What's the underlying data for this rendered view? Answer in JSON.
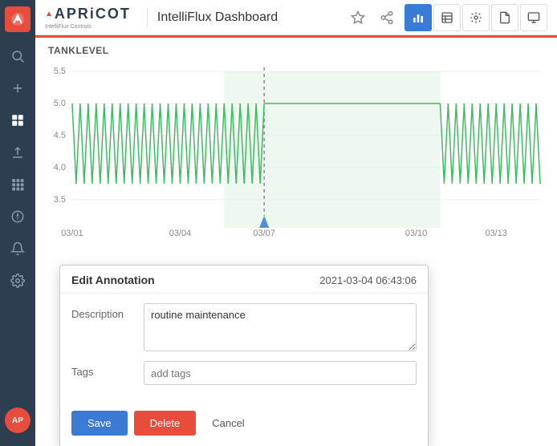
{
  "sidebar": {
    "logo_alt": "APRiCOT logo",
    "items": [
      {
        "name": "search",
        "icon": "search"
      },
      {
        "name": "add",
        "icon": "plus"
      },
      {
        "name": "dashboard",
        "icon": "grid4"
      },
      {
        "name": "upload",
        "icon": "upload"
      },
      {
        "name": "modules",
        "icon": "grid9"
      },
      {
        "name": "navigate",
        "icon": "compass"
      },
      {
        "name": "alerts",
        "icon": "bell"
      },
      {
        "name": "settings",
        "icon": "gear"
      }
    ],
    "avatar_initials": "AP"
  },
  "topbar": {
    "brand": "APRiCOT",
    "brand_sub": "IntelliFlux Controls",
    "title": "IntelliFlux Dashboard",
    "buttons": [
      {
        "name": "chart-icon-btn",
        "label": "Bar chart"
      },
      {
        "name": "table-icon-btn",
        "label": "Table"
      },
      {
        "name": "settings-icon-btn",
        "label": "Settings"
      },
      {
        "name": "file-icon-btn",
        "label": "File"
      },
      {
        "name": "monitor-icon-btn",
        "label": "Monitor"
      }
    ],
    "star_icon": "star",
    "share_icon": "share"
  },
  "chart": {
    "title": "TANKLEVEL",
    "y_labels": [
      "5.5",
      "5.0",
      "4.5",
      "4.0",
      "3.5"
    ],
    "x_labels": [
      "03/01",
      "03/04",
      "03/07",
      "03/10",
      "03/13"
    ],
    "annotation_marker": "2021-03-04"
  },
  "annotation_modal": {
    "title": "Edit Annotation",
    "timestamp": "2021-03-04 06:43:06",
    "description_label": "Description",
    "description_value": "routine maintenance",
    "tags_label": "Tags",
    "tags_placeholder": "add tags",
    "save_label": "Save",
    "delete_label": "Delete",
    "cancel_label": "Cancel"
  }
}
